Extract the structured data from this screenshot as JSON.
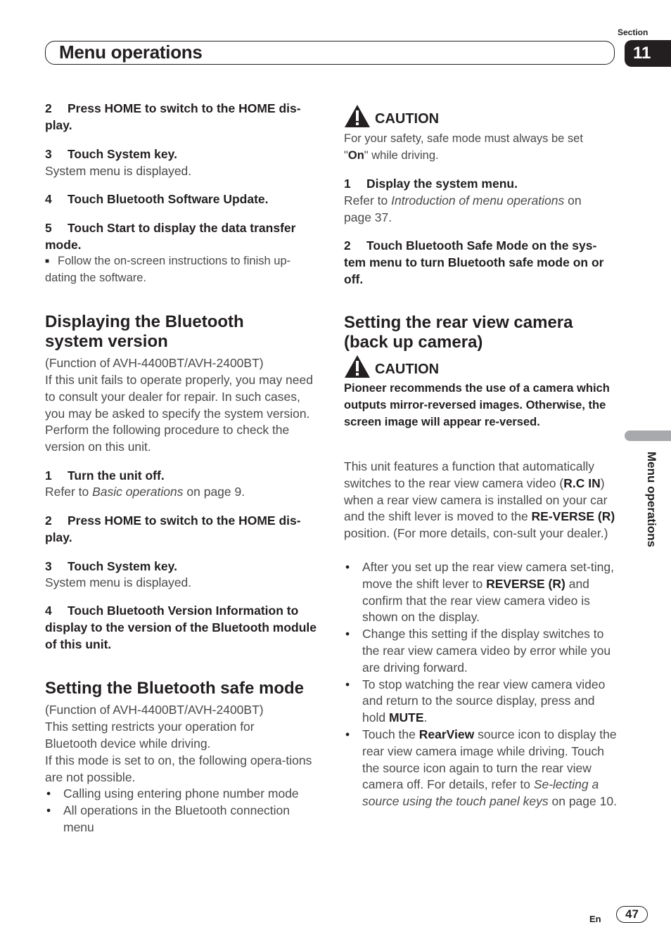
{
  "header": {
    "section_label": "Section",
    "section_number": "11",
    "title": "Menu operations"
  },
  "left": {
    "step2a": {
      "num": "2",
      "text": "Press HOME to switch to the HOME dis-\nplay."
    },
    "step3a": {
      "num": "3",
      "text": "Touch System key."
    },
    "step3a_desc": "System menu is displayed.",
    "step4a": {
      "num": "4",
      "text": "Touch Bluetooth Software Update."
    },
    "step5a": {
      "num": "5",
      "text": "Touch Start to display the data transfer mode."
    },
    "step5a_note": "Follow the on-screen instructions to finish up-dating the software.",
    "version_heading": "Displaying the Bluetooth system version",
    "version_function": "(Function of AVH-4400BT/AVH-2400BT)",
    "version_desc": "If this unit fails to operate properly, you may need to consult your dealer for repair. In such cases, you may be asked to specify the system version. Perform the following procedure to check the version on this unit.",
    "vstep1": {
      "num": "1",
      "text": "Turn the unit off."
    },
    "vstep1_pre": "Refer to ",
    "vstep1_link": "Basic operations",
    "vstep1_post": " on page 9.",
    "vstep2": {
      "num": "2",
      "text": "Press HOME to switch to the HOME dis-play."
    },
    "vstep3": {
      "num": "3",
      "text": "Touch System key."
    },
    "vstep3_desc": "System menu is displayed.",
    "vstep4": {
      "num": "4",
      "text": "Touch Bluetooth Version Information to display to the version of the Bluetooth module of this unit."
    },
    "safe_heading": "Setting the Bluetooth safe mode",
    "safe_function": "(Function of AVH-4400BT/AVH-2400BT)",
    "safe_desc1": "This setting restricts your operation for Bluetooth device while driving.",
    "safe_desc2": "If this mode is set to on, the following opera-tions are not possible.",
    "safe_bullets": [
      "Calling using entering phone number mode",
      "All operations in the Bluetooth connection menu"
    ]
  },
  "right": {
    "caution1_label": "CAUTION",
    "caution1_pre": "For your safety, safe mode must always be set \"",
    "caution1_bold": "On",
    "caution1_post": "\" while driving.",
    "sstep1": {
      "num": "1",
      "text": "Display the system menu."
    },
    "sstep1_pre": "Refer to ",
    "sstep1_link": "Introduction of menu operations",
    "sstep1_post": " on page 37.",
    "sstep2": {
      "num": "2",
      "text": "Touch Bluetooth Safe Mode on the sys-tem menu to turn Bluetooth safe mode on or off."
    },
    "camera_heading": "Setting the rear view camera (back up camera)",
    "caution2_label": "CAUTION",
    "caution2_text": "Pioneer recommends the use of a camera which outputs mirror-reversed images. Otherwise, the screen image will appear re-versed.",
    "camera_p1": "This unit features a function that automatically switches to the rear view camera video (",
    "camera_p1_b1": "R.C IN",
    "camera_p1_mid": ") when a rear view camera is installed on your car and the shift lever is moved to the ",
    "camera_p1_b2": "RE-VERSE (R)",
    "camera_p1_end": "  position. (For more details, con-sult your dealer.)",
    "bullet1_pre": "After you set up the rear view camera set-ting, move the shift lever to ",
    "bullet1_b": "REVERSE (R)",
    "bullet1_post": " and confirm that the rear view camera video is shown on the display.",
    "bullet2": "Change this setting if the display switches to the rear view camera video by error while you are driving forward.",
    "bullet3_pre": "To stop watching the rear view camera video and return to the source display, press and hold ",
    "bullet3_b": "MUTE",
    "bullet3_post": ".",
    "bullet4_pre": "Touch the ",
    "bullet4_b": "RearView",
    "bullet4_mid": " source icon to display the rear view camera image while driving. Touch the source icon again to turn the rear view camera off. For details, refer to ",
    "bullet4_link": "Se-lecting a source using the touch panel keys",
    "bullet4_post": " on page 10."
  },
  "side_tab": {
    "label": "Menu operations"
  },
  "footer": {
    "lang": "En",
    "page": "47"
  }
}
